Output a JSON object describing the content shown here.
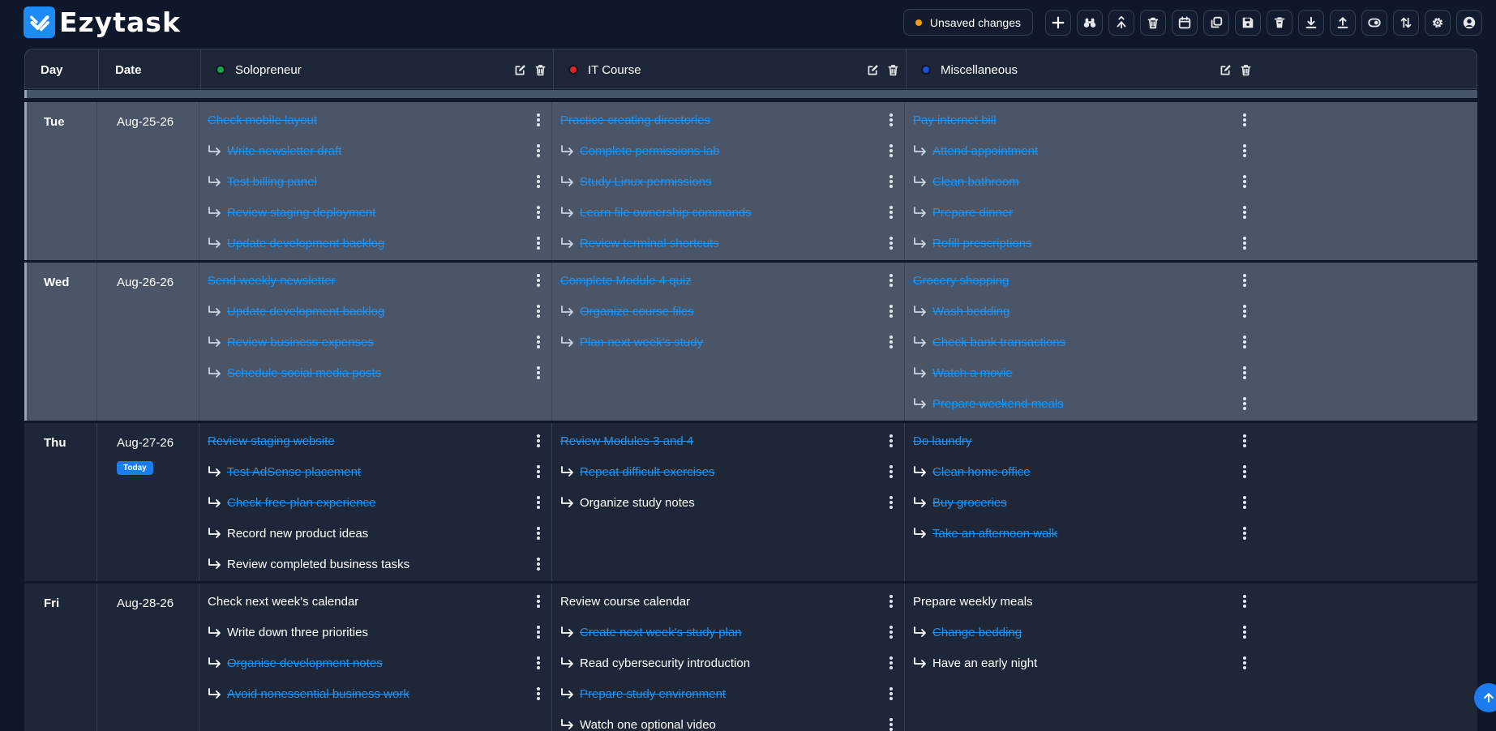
{
  "app": {
    "name": "Ezytask"
  },
  "toolbar": {
    "unsaved_label": "Unsaved changes",
    "unsaved_color": "#f59e0b",
    "buttons": [
      "plus-icon",
      "binoculars-icon",
      "merge-icon",
      "trash-icon",
      "calendar-icon",
      "copy-icon",
      "save-icon",
      "trash-solid-icon",
      "download-icon",
      "upload-icon",
      "toggle-icon",
      "sort-icon",
      "gear-icon",
      "user-icon"
    ]
  },
  "columns": {
    "day": "Day",
    "date": "Date",
    "categories": [
      {
        "name": "Solopreneur",
        "color": "#16a34a"
      },
      {
        "name": "IT Course",
        "color": "#dc2626"
      },
      {
        "name": "Miscellaneous",
        "color": "#1d4ed8"
      }
    ]
  },
  "rows": [
    {
      "day": "Tue",
      "date": "Aug-25-26",
      "state": "past",
      "cells": [
        [
          {
            "text": "Check mobile layout",
            "sub": false,
            "done": true
          },
          {
            "text": "Write newsletter draft",
            "sub": true,
            "done": true
          },
          {
            "text": "Test billing panel",
            "sub": true,
            "done": true
          },
          {
            "text": "Review staging deployment",
            "sub": true,
            "done": true
          },
          {
            "text": "Update development backlog",
            "sub": true,
            "done": true
          }
        ],
        [
          {
            "text": "Practice creating directories",
            "sub": false,
            "done": true
          },
          {
            "text": "Complete permissions lab",
            "sub": true,
            "done": true
          },
          {
            "text": "Study Linux permissions",
            "sub": true,
            "done": true
          },
          {
            "text": "Learn file ownership commands",
            "sub": true,
            "done": true
          },
          {
            "text": "Review terminal shortcuts",
            "sub": true,
            "done": true
          }
        ],
        [
          {
            "text": "Pay internet bill",
            "sub": false,
            "done": true
          },
          {
            "text": "Attend appointment",
            "sub": true,
            "done": true
          },
          {
            "text": "Clean bathroom",
            "sub": true,
            "done": true
          },
          {
            "text": "Prepare dinner",
            "sub": true,
            "done": true
          },
          {
            "text": "Refill prescriptions",
            "sub": true,
            "done": true
          }
        ]
      ]
    },
    {
      "day": "Wed",
      "date": "Aug-26-26",
      "state": "past",
      "cells": [
        [
          {
            "text": "Send weekly newsletter",
            "sub": false,
            "done": true
          },
          {
            "text": "Update development backlog",
            "sub": true,
            "done": true
          },
          {
            "text": "Review business expenses",
            "sub": true,
            "done": true
          },
          {
            "text": "Schedule social media posts",
            "sub": true,
            "done": true
          }
        ],
        [
          {
            "text": "Complete Module 4 quiz",
            "sub": false,
            "done": true
          },
          {
            "text": "Organize course files",
            "sub": true,
            "done": true
          },
          {
            "text": "Plan next week's study",
            "sub": true,
            "done": true
          }
        ],
        [
          {
            "text": "Grocery shopping",
            "sub": false,
            "done": true
          },
          {
            "text": "Wash bedding",
            "sub": true,
            "done": true
          },
          {
            "text": "Check bank transactions",
            "sub": true,
            "done": true
          },
          {
            "text": "Watch a movie",
            "sub": true,
            "done": true
          },
          {
            "text": "Prepare weekend meals",
            "sub": true,
            "done": true
          }
        ]
      ]
    },
    {
      "day": "Thu",
      "date": "Aug-27-26",
      "state": "current",
      "badge": "Today",
      "cells": [
        [
          {
            "text": "Review staging website",
            "sub": false,
            "done": true
          },
          {
            "text": "Test AdSense placement",
            "sub": true,
            "done": true
          },
          {
            "text": "Check free-plan experience",
            "sub": true,
            "done": true
          },
          {
            "text": "Record new product ideas",
            "sub": true,
            "done": false
          },
          {
            "text": "Review completed business tasks",
            "sub": true,
            "done": false
          }
        ],
        [
          {
            "text": "Review Modules 3 and 4",
            "sub": false,
            "done": true
          },
          {
            "text": "Repeat difficult exercises",
            "sub": true,
            "done": true
          },
          {
            "text": "Organize study notes",
            "sub": true,
            "done": false
          }
        ],
        [
          {
            "text": "Do laundry",
            "sub": false,
            "done": true
          },
          {
            "text": "Clean home office",
            "sub": true,
            "done": true
          },
          {
            "text": "Buy groceries",
            "sub": true,
            "done": true
          },
          {
            "text": "Take an afternoon walk",
            "sub": true,
            "done": true
          }
        ]
      ]
    },
    {
      "day": "Fri",
      "date": "Aug-28-26",
      "state": "future",
      "cells": [
        [
          {
            "text": "Check next week's calendar",
            "sub": false,
            "done": false
          },
          {
            "text": "Write down three priorities",
            "sub": true,
            "done": false
          },
          {
            "text": "Organise development notes",
            "sub": true,
            "done": true
          },
          {
            "text": "Avoid nonessential business work",
            "sub": true,
            "done": true
          }
        ],
        [
          {
            "text": "Review course calendar",
            "sub": false,
            "done": false
          },
          {
            "text": "Create next week's study plan",
            "sub": true,
            "done": true
          },
          {
            "text": "Read cybersecurity introduction",
            "sub": true,
            "done": false
          },
          {
            "text": "Prepare study environment",
            "sub": true,
            "done": true
          },
          {
            "text": "Watch one optional video",
            "sub": true,
            "done": false
          }
        ],
        [
          {
            "text": "Prepare weekly meals",
            "sub": false,
            "done": false
          },
          {
            "text": "Change bedding",
            "sub": true,
            "done": true
          },
          {
            "text": "Have an early night",
            "sub": true,
            "done": false
          }
        ]
      ]
    }
  ]
}
